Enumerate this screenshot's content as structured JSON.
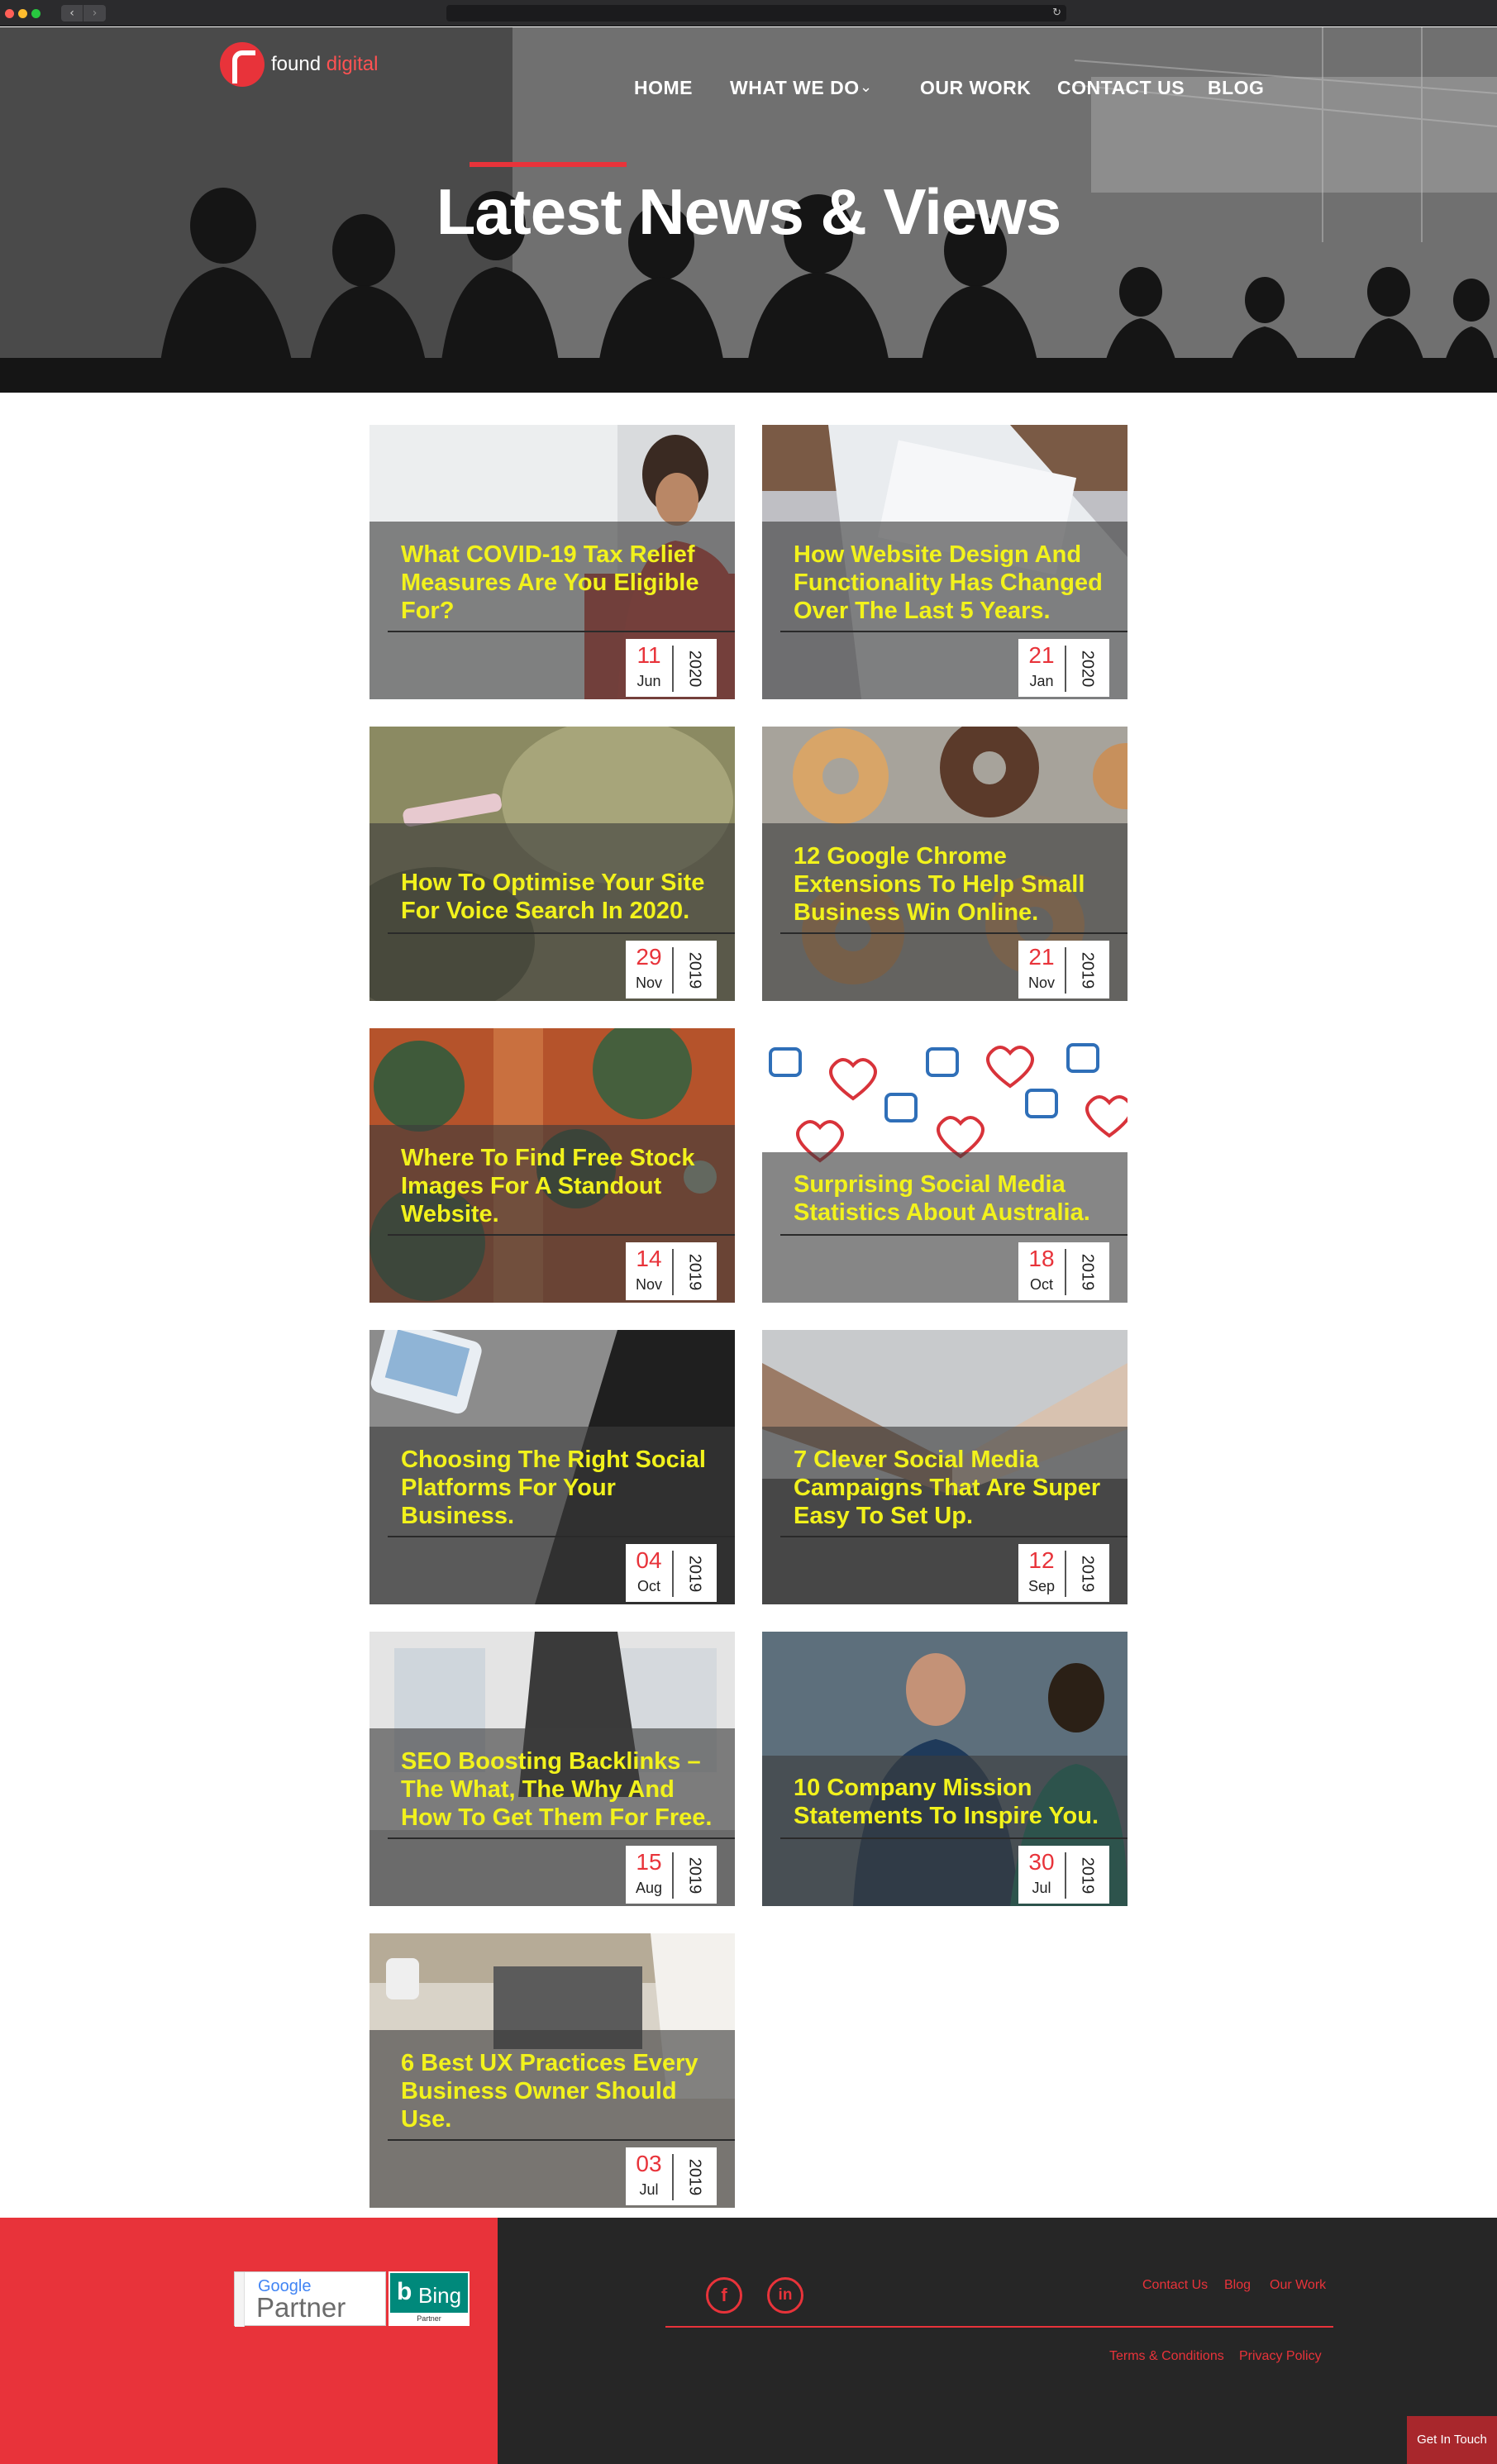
{
  "nav": {
    "logo": {
      "prefix": "found",
      "accent": "digital"
    },
    "items": [
      {
        "label": "HOME"
      },
      {
        "label": "WHAT WE DO"
      },
      {
        "label": "OUR WORK"
      },
      {
        "label": "CONTACT US"
      },
      {
        "label": "BLOG"
      }
    ]
  },
  "hero": {
    "title": "Latest News & Views"
  },
  "posts": [
    {
      "title": "What COVID-19 Tax Relief Measures Are You Eligible For?",
      "day": "11",
      "month": "Jun",
      "year": "2020"
    },
    {
      "title": "How Website Design And Functionality Has Changed Over The Last 5 Years.",
      "day": "21",
      "month": "Jan",
      "year": "2020"
    },
    {
      "title": "How To Optimise Your Site For Voice Search In 2020.",
      "day": "29",
      "month": "Nov",
      "year": "2019"
    },
    {
      "title": "12 Google Chrome Extensions To Help Small Business Win Online.",
      "day": "21",
      "month": "Nov",
      "year": "2019"
    },
    {
      "title": "Where To Find Free Stock Images For A Standout Website.",
      "day": "14",
      "month": "Nov",
      "year": "2019"
    },
    {
      "title": "Surprising Social Media Statistics About Australia.",
      "day": "18",
      "month": "Oct",
      "year": "2019"
    },
    {
      "title": "Choosing The Right Social Platforms For Your Business.",
      "day": "04",
      "month": "Oct",
      "year": "2019"
    },
    {
      "title": "7 Clever Social Media Campaigns That Are Super Easy To Set Up.",
      "day": "12",
      "month": "Sep",
      "year": "2019"
    },
    {
      "title": "SEO Boosting Backlinks – The What, The Why And How To Get Them For Free.",
      "day": "15",
      "month": "Aug",
      "year": "2019"
    },
    {
      "title": "10 Company Mission Statements To Inspire You.",
      "day": "30",
      "month": "Jul",
      "year": "2019"
    },
    {
      "title": "6 Best UX Practices Every Business Owner Should Use.",
      "day": "03",
      "month": "Jul",
      "year": "2019"
    }
  ],
  "footer": {
    "google_badge": {
      "top": "Google",
      "main": "Partner"
    },
    "bing_badge": {
      "main": "Bing",
      "sub": "Partner"
    },
    "links_top": [
      "Contact Us",
      "Blog",
      "Our Work"
    ],
    "links_bottom": [
      "Terms  & Conditions",
      "Privacy Policy"
    ],
    "get_in_touch": "Get In Touch"
  },
  "colors": {
    "accent": "#e8333a",
    "title_yellow": "#f2f21c",
    "footer_dark": "#262626"
  },
  "icons": [
    "facebook-icon",
    "linkedin-icon",
    "chevron-down-icon"
  ]
}
